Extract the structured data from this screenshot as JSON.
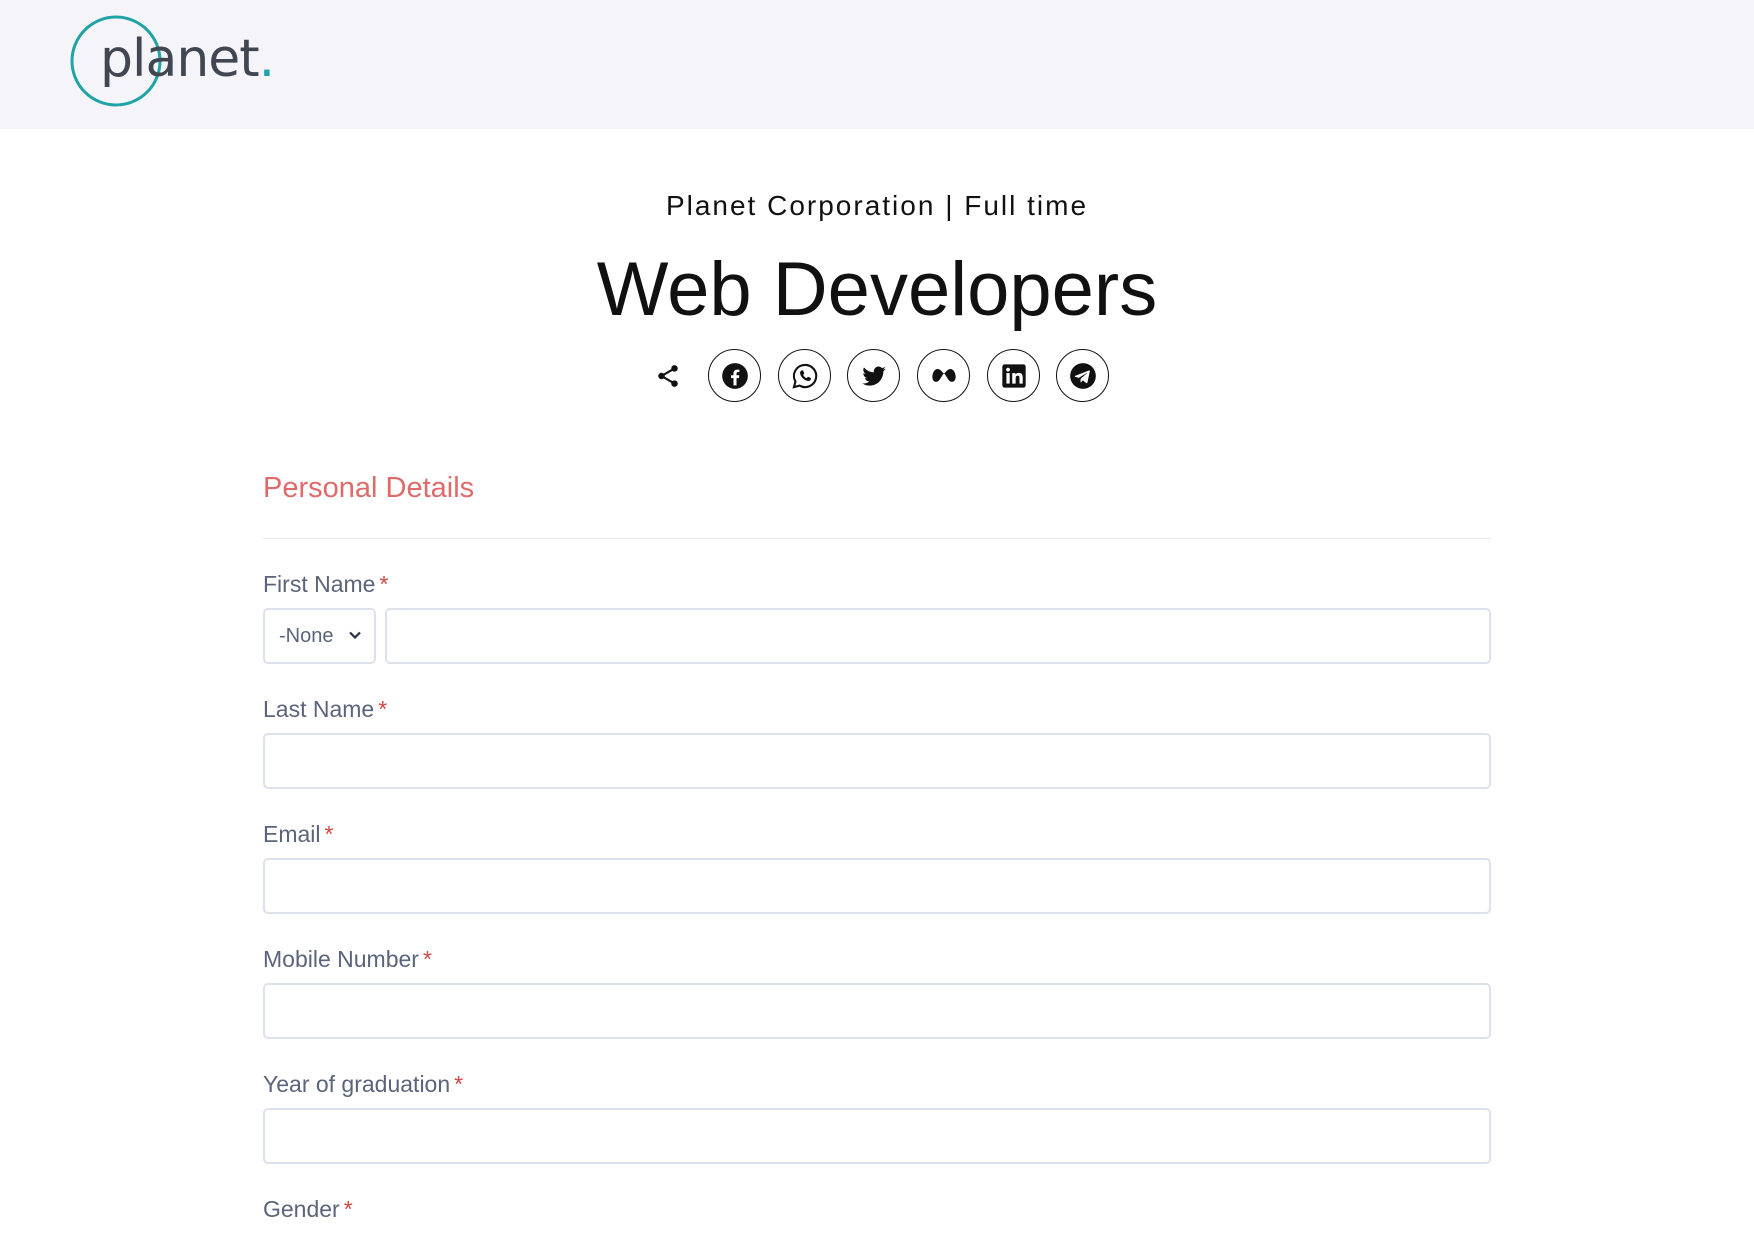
{
  "logo": {
    "word": "planet",
    "dot": "."
  },
  "job": {
    "subtitle": "Planet Corporation | Full time",
    "title": "Web Developers"
  },
  "share": {
    "icons": [
      "share-icon",
      "facebook-icon",
      "whatsapp-icon",
      "twitter-icon",
      "meta-icon",
      "linkedin-icon",
      "telegram-icon"
    ]
  },
  "form": {
    "section_title": "Personal Details",
    "required_mark": "*",
    "first_name": {
      "label": "First Name",
      "salutation": "-None",
      "value": ""
    },
    "last_name": {
      "label": "Last Name",
      "value": ""
    },
    "email": {
      "label": "Email",
      "value": ""
    },
    "mobile": {
      "label": "Mobile Number",
      "value": ""
    },
    "graduation": {
      "label": "Year of graduation",
      "value": ""
    },
    "gender": {
      "label": "Gender"
    }
  },
  "colors": {
    "accent": "#e06a6a",
    "brand_teal": "#1fa3a6",
    "label": "#5b647a",
    "required": "#d64545",
    "header_bg": "#f5f5f9"
  }
}
